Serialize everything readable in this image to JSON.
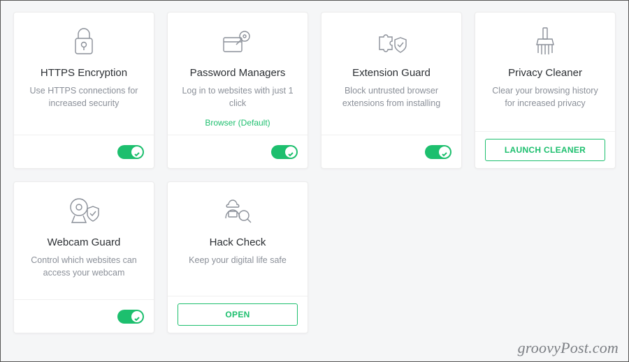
{
  "cards": [
    {
      "id": "https-encryption",
      "icon": "lock-icon",
      "title": "HTTPS Encryption",
      "desc": "Use HTTPS connections for increased security",
      "note": "",
      "action": {
        "type": "toggle",
        "on": true
      }
    },
    {
      "id": "password-managers",
      "icon": "key-icon",
      "title": "Password Managers",
      "desc": "Log in to websites with just 1 click",
      "note": "Browser (Default)",
      "action": {
        "type": "toggle",
        "on": true
      }
    },
    {
      "id": "extension-guard",
      "icon": "puzzle-shield-icon",
      "title": "Extension Guard",
      "desc": "Block untrusted browser extensions from installing",
      "note": "",
      "action": {
        "type": "toggle",
        "on": true
      }
    },
    {
      "id": "privacy-cleaner",
      "icon": "brush-icon",
      "title": "Privacy Cleaner",
      "desc": "Clear your browsing history for increased privacy",
      "note": "",
      "action": {
        "type": "button",
        "label": "LAUNCH CLEANER"
      }
    },
    {
      "id": "webcam-guard",
      "icon": "webcam-shield-icon",
      "title": "Webcam Guard",
      "desc": "Control which websites can access your webcam",
      "note": "",
      "action": {
        "type": "toggle",
        "on": true
      }
    },
    {
      "id": "hack-check",
      "icon": "hacker-search-icon",
      "title": "Hack Check",
      "desc": "Keep your digital life safe",
      "note": "",
      "action": {
        "type": "button",
        "label": "OPEN"
      }
    }
  ],
  "watermark": "groovyPost.com"
}
